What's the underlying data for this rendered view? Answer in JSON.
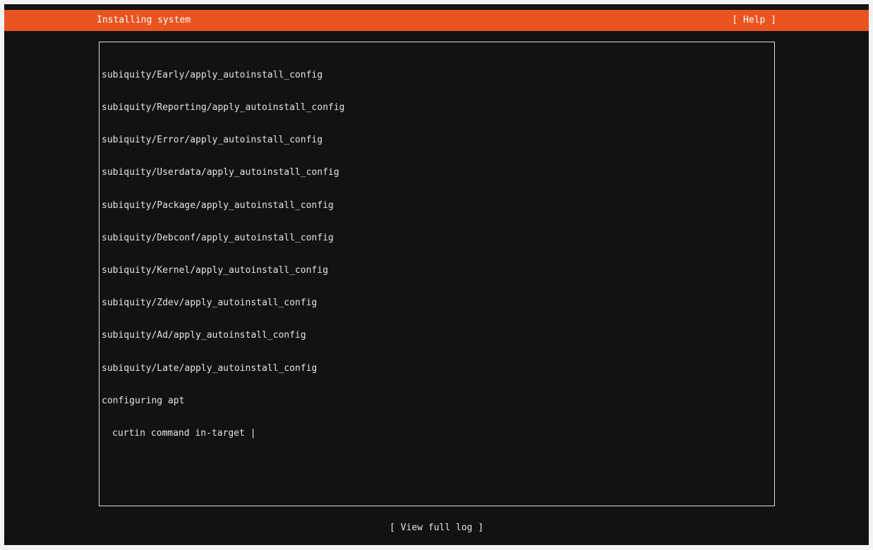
{
  "header": {
    "title": "Installing system",
    "help_label": "[ Help ]"
  },
  "log": {
    "lines": [
      "subiquity/Early/apply_autoinstall_config",
      "subiquity/Reporting/apply_autoinstall_config",
      "subiquity/Error/apply_autoinstall_config",
      "subiquity/Userdata/apply_autoinstall_config",
      "subiquity/Package/apply_autoinstall_config",
      "subiquity/Debconf/apply_autoinstall_config",
      "subiquity/Kernel/apply_autoinstall_config",
      "subiquity/Zdev/apply_autoinstall_config",
      "subiquity/Ad/apply_autoinstall_config",
      "subiquity/Late/apply_autoinstall_config",
      "configuring apt",
      "curtin command in-target |"
    ]
  },
  "footer": {
    "view_log_label": "[ View full log ]"
  },
  "colors": {
    "accent": "#e95420",
    "background": "#121212",
    "text": "#e4e4e4"
  }
}
